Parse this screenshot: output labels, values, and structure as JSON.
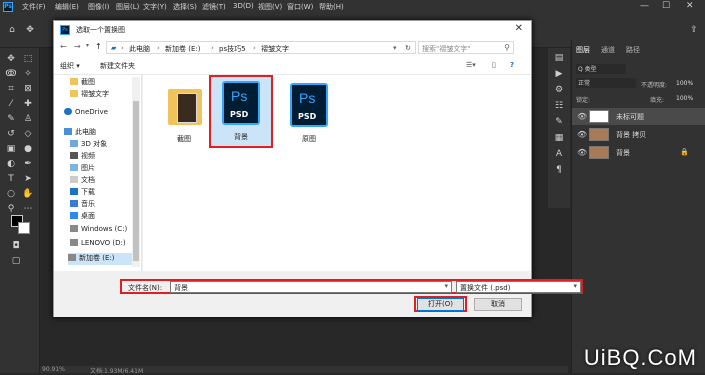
{
  "app": {
    "logo": "Ps",
    "menu": [
      "文件(F)",
      "编辑(E)",
      "图像(I)",
      "图层(L)",
      "文字(Y)",
      "选择(S)",
      "滤镜(T)",
      "3D(D)",
      "视图(V)",
      "窗口(W)",
      "帮助(H)"
    ],
    "window_buttons": [
      "—",
      "☐",
      "✕"
    ]
  },
  "statusbar": {
    "zoom": "90.91%",
    "doc": "文档:1.93M/6.41M"
  },
  "panel": {
    "tabs": [
      "图层",
      "通道",
      "路径"
    ],
    "kind": "Q 类型",
    "blend": "正常",
    "opacity_label": "不透明度:",
    "opacity": "100%",
    "lock_label": "锁定:",
    "fill_label": "填充:",
    "fill": "100%",
    "layers": [
      {
        "name": "未标可题",
        "selected": true
      },
      {
        "name": "背景 拷贝",
        "selected": false
      },
      {
        "name": "背景",
        "selected": false
      }
    ]
  },
  "dialog": {
    "title": "选取一个置换图",
    "close": "✕",
    "nav": {
      "back": "←",
      "forward": "→",
      "up": "↑",
      "refresh": "↻"
    },
    "breadcrumb": [
      "此电脑",
      "新加卷 (E:)",
      "ps技巧5",
      "褶皱文字"
    ],
    "search_placeholder": "搜索\"褶皱文字\"",
    "toolbar": {
      "organize": "组织 ▾",
      "new_folder": "新建文件夹"
    },
    "sidebar": [
      "截图",
      "褶皱文字",
      "OneDrive",
      "此电脑",
      "3D 对象",
      "视频",
      "图片",
      "文档",
      "下载",
      "音乐",
      "桌面",
      "Windows (C:)",
      "LENOVO (D:)",
      "新加卷 (E:)"
    ],
    "files": [
      {
        "name": "截图",
        "type": "folder"
      },
      {
        "name": "背景",
        "type": "psd",
        "selected": true
      },
      {
        "name": "原图",
        "type": "psd"
      }
    ],
    "ps_text": "Ps",
    "psd_text": "PSD",
    "filename_label": "文件名(N):",
    "filename": "背景",
    "filetype": "置换文件 (.psd)",
    "open": "打开(O)",
    "cancel": "取消"
  },
  "watermark": "UiBQ.CoM",
  "colors": {
    "ps_blue": "#31a8ff",
    "highlight": "#e02020",
    "selection": "#cce4f7"
  }
}
